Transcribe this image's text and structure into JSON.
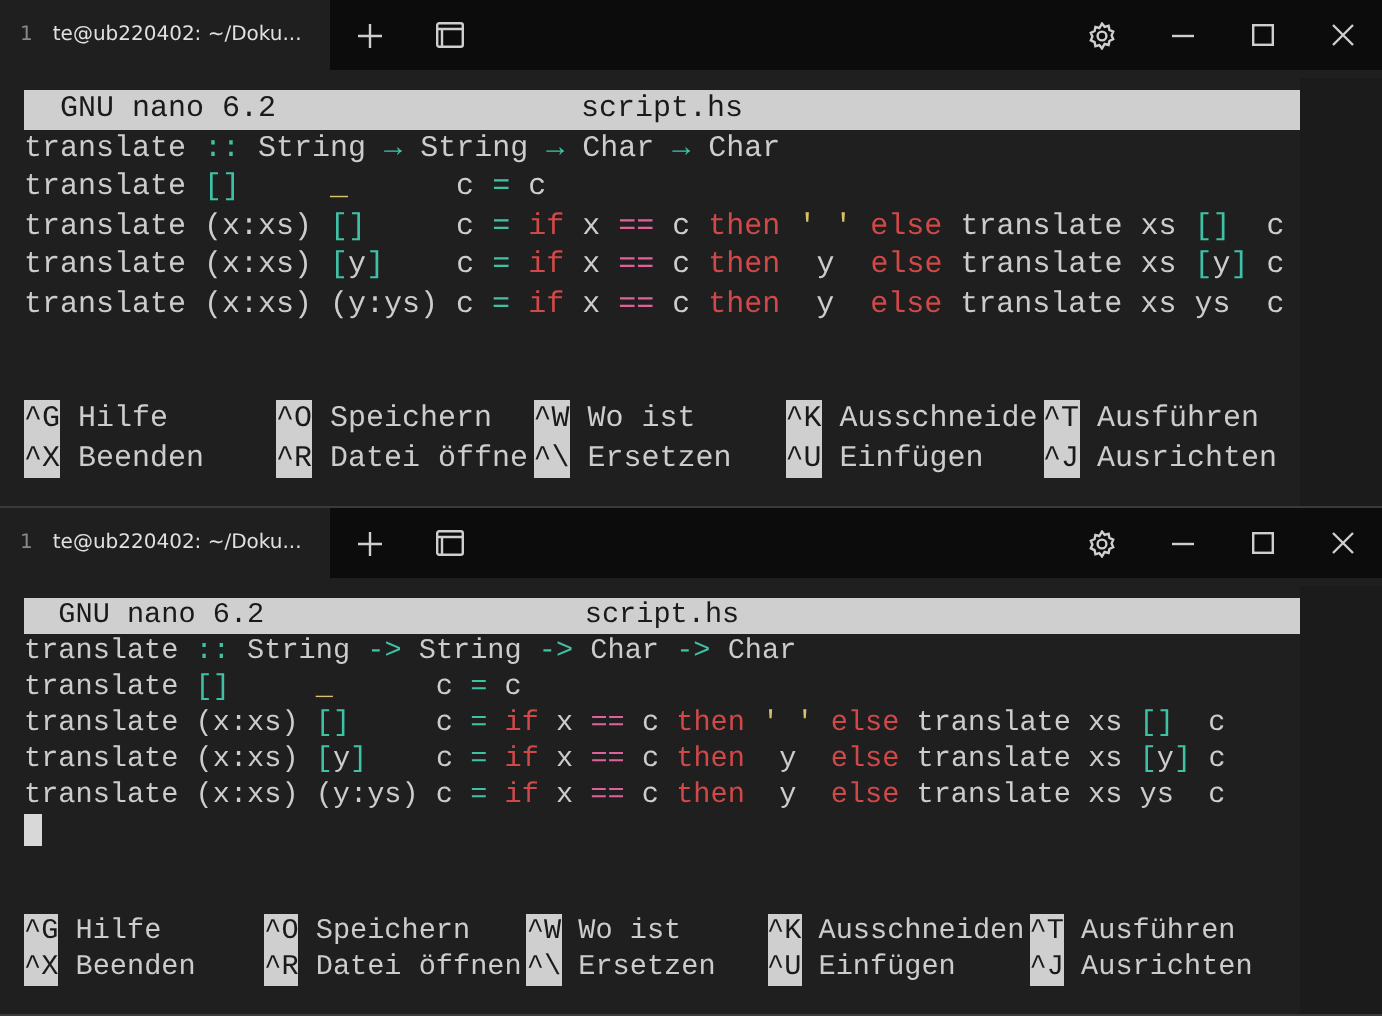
{
  "windows": [
    {
      "tab": {
        "number": "1",
        "title": "te@ub220402: ~/Doku..."
      },
      "header": {
        "version": "GNU nano 6.2",
        "filename": "script.hs"
      },
      "lines": [
        [
          {
            "text": "translate ",
            "kind": "plain"
          },
          {
            "text": "::",
            "kind": "symbol"
          },
          {
            "text": " String ",
            "kind": "plain"
          },
          {
            "text": "→",
            "kind": "symbol"
          },
          {
            "text": " String ",
            "kind": "plain"
          },
          {
            "text": "→",
            "kind": "symbol"
          },
          {
            "text": " Char ",
            "kind": "plain"
          },
          {
            "text": "→",
            "kind": "symbol"
          },
          {
            "text": " Char",
            "kind": "plain"
          }
        ],
        [
          {
            "text": "translate ",
            "kind": "plain"
          },
          {
            "text": "[]     ",
            "kind": "symbol"
          },
          {
            "text": "_      ",
            "kind": "literal"
          },
          {
            "text": "c ",
            "kind": "plain"
          },
          {
            "text": "= ",
            "kind": "symbol"
          },
          {
            "text": "c",
            "kind": "plain"
          }
        ],
        [
          {
            "text": "translate (x:xs) ",
            "kind": "plain"
          },
          {
            "text": "[]     ",
            "kind": "symbol"
          },
          {
            "text": "c ",
            "kind": "plain"
          },
          {
            "text": "= ",
            "kind": "symbol"
          },
          {
            "text": "if ",
            "kind": "keyword"
          },
          {
            "text": "x ",
            "kind": "plain"
          },
          {
            "text": "== ",
            "kind": "operator"
          },
          {
            "text": "c ",
            "kind": "plain"
          },
          {
            "text": "then ",
            "kind": "keyword"
          },
          {
            "text": "' ' ",
            "kind": "literal"
          },
          {
            "text": "else ",
            "kind": "keyword"
          },
          {
            "text": "translate xs ",
            "kind": "plain"
          },
          {
            "text": "[]  ",
            "kind": "symbol"
          },
          {
            "text": "c",
            "kind": "plain"
          }
        ],
        [
          {
            "text": "translate (x:xs) ",
            "kind": "plain"
          },
          {
            "text": "[",
            "kind": "symbol"
          },
          {
            "text": "y",
            "kind": "plain"
          },
          {
            "text": "]    ",
            "kind": "symbol"
          },
          {
            "text": "c ",
            "kind": "plain"
          },
          {
            "text": "= ",
            "kind": "symbol"
          },
          {
            "text": "if ",
            "kind": "keyword"
          },
          {
            "text": "x ",
            "kind": "plain"
          },
          {
            "text": "== ",
            "kind": "operator"
          },
          {
            "text": "c ",
            "kind": "plain"
          },
          {
            "text": "then ",
            "kind": "keyword"
          },
          {
            "text": " y  ",
            "kind": "plain"
          },
          {
            "text": "else ",
            "kind": "keyword"
          },
          {
            "text": "translate xs ",
            "kind": "plain"
          },
          {
            "text": "[",
            "kind": "symbol"
          },
          {
            "text": "y",
            "kind": "plain"
          },
          {
            "text": "] ",
            "kind": "symbol"
          },
          {
            "text": "c",
            "kind": "plain"
          }
        ],
        [
          {
            "text": "translate (x:xs) (y:ys) c ",
            "kind": "plain"
          },
          {
            "text": "= ",
            "kind": "symbol"
          },
          {
            "text": "if ",
            "kind": "keyword"
          },
          {
            "text": "x ",
            "kind": "plain"
          },
          {
            "text": "== ",
            "kind": "operator"
          },
          {
            "text": "c ",
            "kind": "plain"
          },
          {
            "text": "then ",
            "kind": "keyword"
          },
          {
            "text": " y  ",
            "kind": "plain"
          },
          {
            "text": "else ",
            "kind": "keyword"
          },
          {
            "text": "translate xs ys  c",
            "kind": "plain"
          }
        ]
      ],
      "shortcuts": [
        {
          "key": "^G",
          "label": "Hilfe"
        },
        {
          "key": "^O",
          "label": "Speichern"
        },
        {
          "key": "^W",
          "label": "Wo ist"
        },
        {
          "key": "^K",
          "label": "Ausschneide"
        },
        {
          "key": "^T",
          "label": "Ausführen"
        },
        {
          "key": "^X",
          "label": "Beenden"
        },
        {
          "key": "^R",
          "label": "Datei öffne"
        },
        {
          "key": "^\\",
          "label": "Ersetzen"
        },
        {
          "key": "^U",
          "label": "Einfügen"
        },
        {
          "key": "^J",
          "label": "Ausrichten"
        }
      ]
    },
    {
      "tab": {
        "number": "1",
        "title": "te@ub220402: ~/Doku..."
      },
      "header": {
        "version": "GNU nano 6.2",
        "filename": "script.hs"
      },
      "lines": [
        [
          {
            "text": "translate ",
            "kind": "plain"
          },
          {
            "text": "::",
            "kind": "symbol"
          },
          {
            "text": " String ",
            "kind": "plain"
          },
          {
            "text": "->",
            "kind": "symbol"
          },
          {
            "text": " String ",
            "kind": "plain"
          },
          {
            "text": "->",
            "kind": "symbol"
          },
          {
            "text": " Char ",
            "kind": "plain"
          },
          {
            "text": "->",
            "kind": "symbol"
          },
          {
            "text": " Char",
            "kind": "plain"
          }
        ],
        [
          {
            "text": "translate ",
            "kind": "plain"
          },
          {
            "text": "[]     ",
            "kind": "symbol"
          },
          {
            "text": "_      ",
            "kind": "literal"
          },
          {
            "text": "c ",
            "kind": "plain"
          },
          {
            "text": "= ",
            "kind": "symbol"
          },
          {
            "text": "c",
            "kind": "plain"
          }
        ],
        [
          {
            "text": "translate (x:xs) ",
            "kind": "plain"
          },
          {
            "text": "[]     ",
            "kind": "symbol"
          },
          {
            "text": "c ",
            "kind": "plain"
          },
          {
            "text": "= ",
            "kind": "symbol"
          },
          {
            "text": "if ",
            "kind": "keyword"
          },
          {
            "text": "x ",
            "kind": "plain"
          },
          {
            "text": "== ",
            "kind": "operator"
          },
          {
            "text": "c ",
            "kind": "plain"
          },
          {
            "text": "then ",
            "kind": "keyword"
          },
          {
            "text": "' ' ",
            "kind": "literal"
          },
          {
            "text": "else ",
            "kind": "keyword"
          },
          {
            "text": "translate xs ",
            "kind": "plain"
          },
          {
            "text": "[]  ",
            "kind": "symbol"
          },
          {
            "text": "c",
            "kind": "plain"
          }
        ],
        [
          {
            "text": "translate (x:xs) ",
            "kind": "plain"
          },
          {
            "text": "[",
            "kind": "symbol"
          },
          {
            "text": "y",
            "kind": "plain"
          },
          {
            "text": "]    ",
            "kind": "symbol"
          },
          {
            "text": "c ",
            "kind": "plain"
          },
          {
            "text": "= ",
            "kind": "symbol"
          },
          {
            "text": "if ",
            "kind": "keyword"
          },
          {
            "text": "x ",
            "kind": "plain"
          },
          {
            "text": "== ",
            "kind": "operator"
          },
          {
            "text": "c ",
            "kind": "plain"
          },
          {
            "text": "then ",
            "kind": "keyword"
          },
          {
            "text": " y  ",
            "kind": "plain"
          },
          {
            "text": "else ",
            "kind": "keyword"
          },
          {
            "text": "translate xs ",
            "kind": "plain"
          },
          {
            "text": "[",
            "kind": "symbol"
          },
          {
            "text": "y",
            "kind": "plain"
          },
          {
            "text": "] ",
            "kind": "symbol"
          },
          {
            "text": "c",
            "kind": "plain"
          }
        ],
        [
          {
            "text": "translate (x:xs) (y:ys) c ",
            "kind": "plain"
          },
          {
            "text": "= ",
            "kind": "symbol"
          },
          {
            "text": "if ",
            "kind": "keyword"
          },
          {
            "text": "x ",
            "kind": "plain"
          },
          {
            "text": "== ",
            "kind": "operator"
          },
          {
            "text": "c ",
            "kind": "plain"
          },
          {
            "text": "then ",
            "kind": "keyword"
          },
          {
            "text": " y  ",
            "kind": "plain"
          },
          {
            "text": "else ",
            "kind": "keyword"
          },
          {
            "text": "translate xs ys  c",
            "kind": "plain"
          }
        ]
      ],
      "cursor_visible": true,
      "shortcuts": [
        {
          "key": "^G",
          "label": "Hilfe"
        },
        {
          "key": "^O",
          "label": "Speichern"
        },
        {
          "key": "^W",
          "label": "Wo ist"
        },
        {
          "key": "^K",
          "label": "Ausschneiden"
        },
        {
          "key": "^T",
          "label": "Ausführen"
        },
        {
          "key": "^X",
          "label": "Beenden"
        },
        {
          "key": "^R",
          "label": "Datei öffnen"
        },
        {
          "key": "^\\",
          "label": "Ersetzen"
        },
        {
          "key": "^U",
          "label": "Einfügen"
        },
        {
          "key": "^J",
          "label": "Ausrichten"
        }
      ]
    }
  ]
}
